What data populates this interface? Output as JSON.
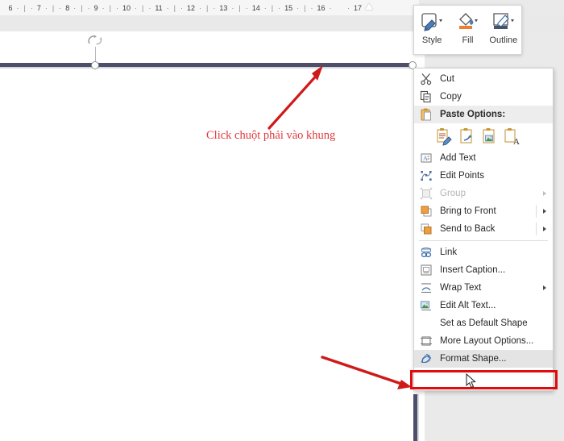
{
  "ruler": {
    "name": "horizontal-ruler",
    "numbers": [
      "6",
      "7",
      "8",
      "9",
      "10",
      "11",
      "12",
      "13",
      "14",
      "15",
      "16",
      "17"
    ],
    "unit_separator": "·",
    "tick_separator": "|"
  },
  "annotation": {
    "text": "Click chuột phải vào khung",
    "color": "#e0393e",
    "arrow_to_shape": "red-arrow-up",
    "arrow_to_format_shape": "red-arrow-down"
  },
  "shape": {
    "name": "selected-line-shape",
    "stroke_color": "#4d5068",
    "rotation_handle": "rotate-icon",
    "handles": [
      "middle-handle",
      "right-handle"
    ]
  },
  "mini_toolbar": {
    "name": "floating-mini-toolbar",
    "buttons": [
      {
        "label": "Style",
        "icon": "shape-style-icon"
      },
      {
        "label": "Fill",
        "icon": "fill-bucket-icon",
        "accent": "#ed7d31"
      },
      {
        "label": "Outline",
        "icon": "shape-outline-icon",
        "accent": "#44546a"
      }
    ]
  },
  "context_menu": {
    "name": "shape-context-menu",
    "items": [
      {
        "label": "Cut",
        "icon": "scissors-icon",
        "type": "item"
      },
      {
        "label": "Copy",
        "icon": "copy-icon",
        "type": "item"
      },
      {
        "label": "Paste Options:",
        "icon": "clipboard-icon",
        "type": "header"
      },
      {
        "label": "paste-gallery",
        "type": "paste-row",
        "options": [
          {
            "name": "keep-source-formatting-icon"
          },
          {
            "name": "merge-formatting-icon"
          },
          {
            "name": "picture-icon"
          },
          {
            "name": "keep-text-only-icon"
          }
        ]
      },
      {
        "label": "Add Text",
        "icon": "add-text-icon",
        "type": "item"
      },
      {
        "label": "Edit Points",
        "icon": "edit-points-icon",
        "type": "item"
      },
      {
        "label": "Group",
        "icon": "group-icon",
        "type": "item",
        "disabled": true,
        "submenu": true
      },
      {
        "label": "Bring to Front",
        "icon": "bring-to-front-icon",
        "type": "item",
        "submenu": true
      },
      {
        "label": "Send to Back",
        "icon": "send-to-back-icon",
        "type": "item",
        "submenu": true
      },
      {
        "label": "separator",
        "type": "separator"
      },
      {
        "label": "Link",
        "icon": "link-icon",
        "type": "item"
      },
      {
        "label": "Insert Caption...",
        "icon": "insert-caption-icon",
        "type": "item"
      },
      {
        "label": "Wrap Text",
        "icon": "wrap-text-icon",
        "type": "item",
        "submenu": true
      },
      {
        "label": "Edit Alt Text...",
        "icon": "alt-text-icon",
        "type": "item"
      },
      {
        "label": "Set as Default Shape",
        "icon": "none",
        "type": "item"
      },
      {
        "label": "More Layout Options...",
        "icon": "layout-options-icon",
        "type": "item"
      },
      {
        "label": "Format Shape...",
        "icon": "format-shape-icon",
        "type": "item",
        "highlighted": true
      }
    ]
  },
  "highlight_box": {
    "name": "format-shape-highlight",
    "color": "#e00c0c"
  }
}
